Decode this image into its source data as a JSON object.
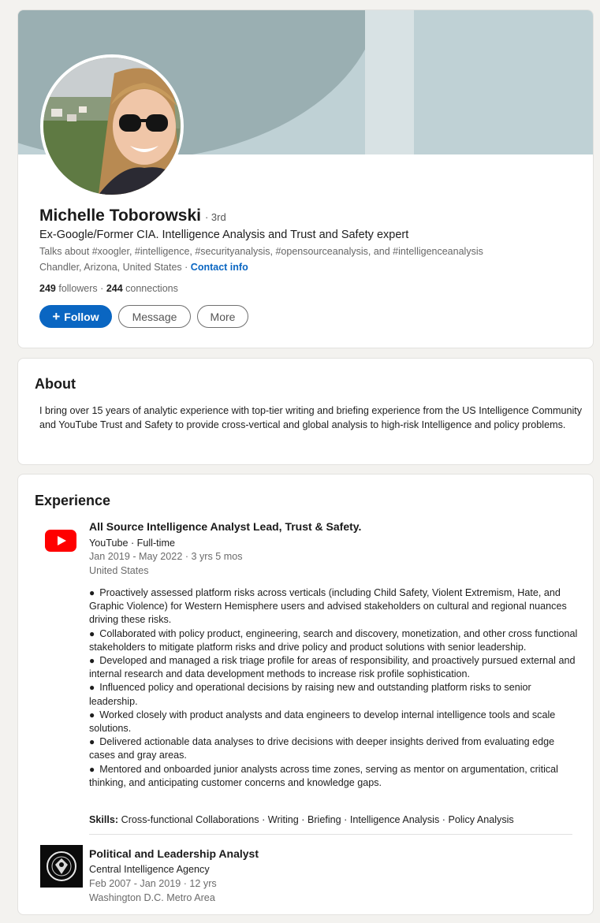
{
  "profile": {
    "name": "Michelle Toborowski",
    "degree": "· 3rd",
    "headline": "Ex-Google/Former CIA. Intelligence Analysis and Trust and Safety expert",
    "talks_about": "Talks about #xoogler, #intelligence, #securityanalysis, #opensourceanalysis, and #intelligenceanalysis",
    "location": "Chandler, Arizona, United States ·",
    "contact_info": "Contact info",
    "followers_count": "249",
    "followers_label": "followers",
    "connections_sep": "·",
    "connections_count": "244",
    "connections_label": "connections",
    "actions": {
      "follow_icon": "+",
      "follow": "Follow",
      "message": "Message",
      "more": "More"
    },
    "colors": {
      "primary": "#0a66c2",
      "banner_light": "#bfd1d5",
      "banner_dark": "#9aafb2"
    }
  },
  "about": {
    "title": "About",
    "text": "I bring over 15 years of analytic experience with top-tier writing and briefing experience from the US Intelligence Community and YouTube Trust and Safety to provide cross-vertical and global analysis to high-risk Intelligence and policy problems."
  },
  "experience": {
    "title": "Experience",
    "entries": [
      {
        "logo_icon": "youtube-logo-icon",
        "title": "All Source Intelligence Analyst Lead, Trust & Safety.",
        "company": "YouTube · Full-time",
        "dates": "Jan 2019 - May 2022 · 3 yrs 5 mos",
        "location": "United States",
        "bullets": [
          "Proactively assessed platform risks across verticals (including Child Safety, Violent Extremism, Hate, and Graphic Violence) for Western Hemisphere users and advised stakeholders on cultural and regional nuances driving these risks.",
          "Collaborated with policy product, engineering, search and discovery, monetization, and other cross functional stakeholders to mitigate platform risks and drive policy and product solutions with senior leadership.",
          "Developed and managed a risk triage profile for areas of responsibility, and proactively pursued external and internal research and data development methods to increase risk profile sophistication.",
          "Influenced policy and operational decisions by raising new and outstanding platform risks to senior leadership.",
          "Worked closely with product analysts and data engineers to develop internal intelligence tools and scale solutions.",
          "Delivered actionable data analyses to drive decisions with deeper insights derived from evaluating edge cases and gray areas.",
          "Mentored and onboarded junior analysts across time zones, serving as mentor on argumentation, critical thinking, and anticipating customer concerns and knowledge gaps."
        ],
        "skills_label": "Skills:",
        "skills": "Cross-functional Collaborations · Writing · Briefing · Intelligence Analysis · Policy Analysis"
      },
      {
        "logo_icon": "cia-seal-icon",
        "title": "Political and Leadership Analyst",
        "company": "Central Intelligence Agency",
        "dates": "Feb 2007 - Jan 2019 · 12 yrs",
        "location": "Washington D.C. Metro Area"
      }
    ]
  }
}
